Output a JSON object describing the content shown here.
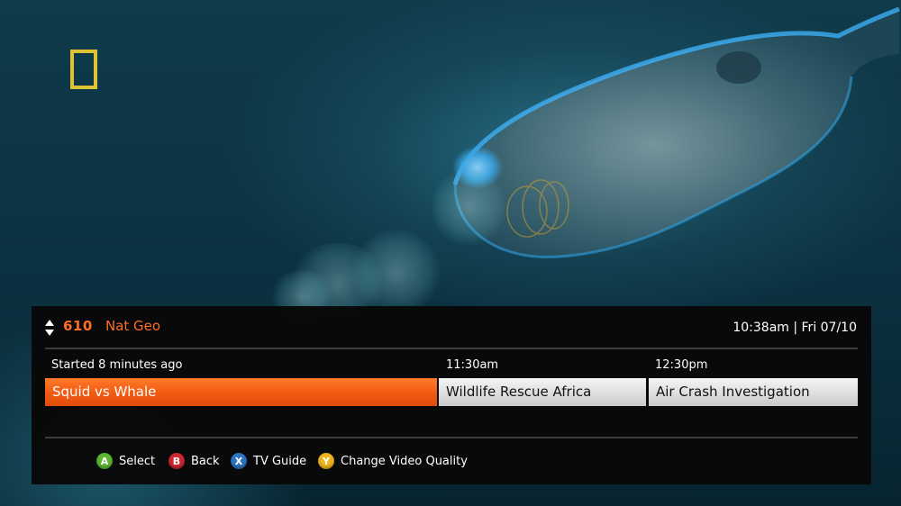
{
  "channel": {
    "number": "610",
    "name": "Nat Geo"
  },
  "datetime": "10:38am | Fri 07/10",
  "schedule": {
    "time_labels": [
      "Started 8 minutes ago",
      "11:30am",
      "12:30pm"
    ],
    "programs": [
      "Squid vs Whale",
      "Wildlife Rescue Africa",
      "Air Crash Investigation"
    ]
  },
  "controls": [
    {
      "key": "A",
      "label": "Select",
      "color": "#5cb630"
    },
    {
      "key": "B",
      "label": "Back",
      "color": "#d22630"
    },
    {
      "key": "X",
      "label": "TV Guide",
      "color": "#2f74c0"
    },
    {
      "key": "Y",
      "label": "Change Video Quality",
      "color": "#f2b51d"
    }
  ],
  "colors": {
    "accent": "#ff6d21",
    "panel_background": "#080808",
    "logo_yellow": "#e0c235"
  },
  "icons": {
    "channel_switch": "up-down-arrows-icon",
    "logo": "national-geographic-yellow-border"
  }
}
